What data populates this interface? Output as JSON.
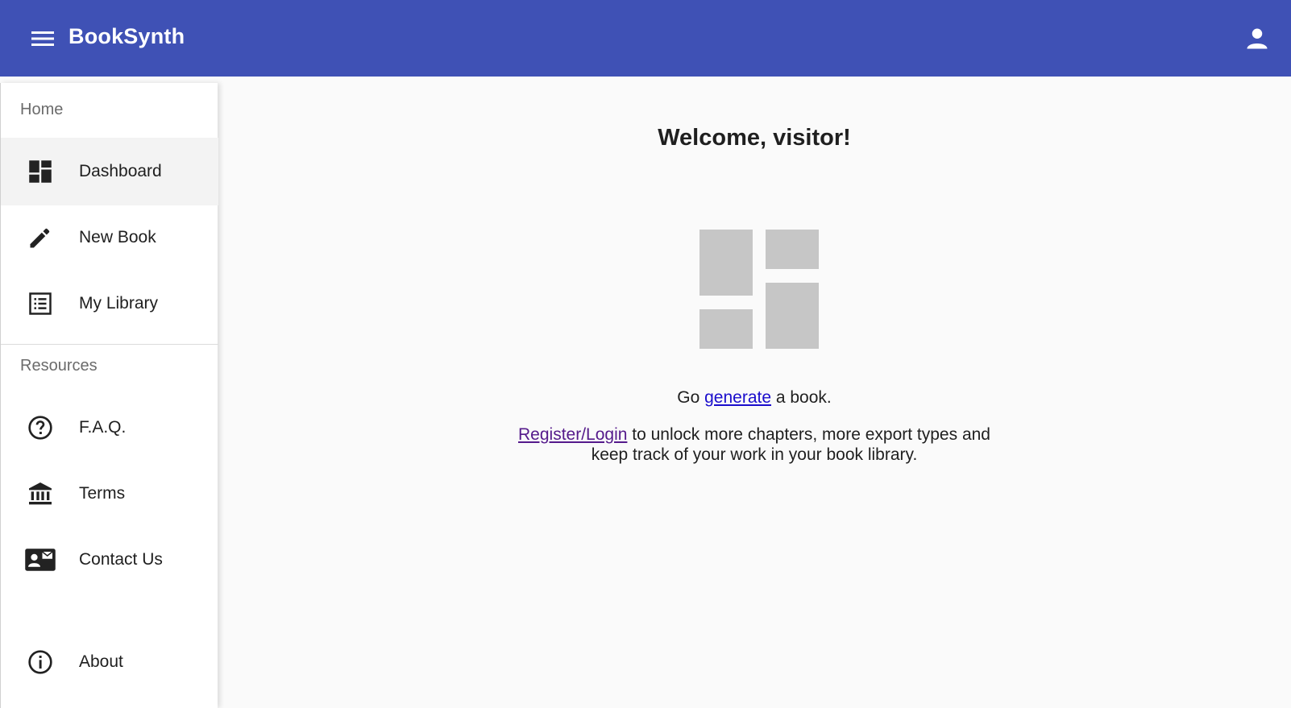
{
  "app": {
    "title": "BookSynth",
    "brand_color": "#3f51b5",
    "icons": {
      "menu": "menu-icon",
      "account": "account-icon"
    }
  },
  "sidebar": {
    "home_section": "Home",
    "resources_section": "Resources",
    "items": [
      {
        "label": "Dashboard",
        "icon": "dashboard-icon",
        "active": true
      },
      {
        "label": "New Book",
        "icon": "pencil-icon"
      },
      {
        "label": "My Library",
        "icon": "list-icon"
      },
      {
        "label": "F.A.Q.",
        "icon": "help-circle-icon"
      },
      {
        "label": "Terms",
        "icon": "bank-icon"
      },
      {
        "label": "Contact Us",
        "icon": "contact-mail-icon"
      },
      {
        "label": "About",
        "icon": "info-icon"
      }
    ]
  },
  "main": {
    "welcome": "Welcome, visitor!",
    "go_prefix": "Go ",
    "generate_link": "generate",
    "go_suffix": " a book.",
    "register_link": "Register/Login",
    "register_text_1": " to unlock more chapters, more export types and",
    "register_text_2": "keep track of your work in your book library."
  }
}
